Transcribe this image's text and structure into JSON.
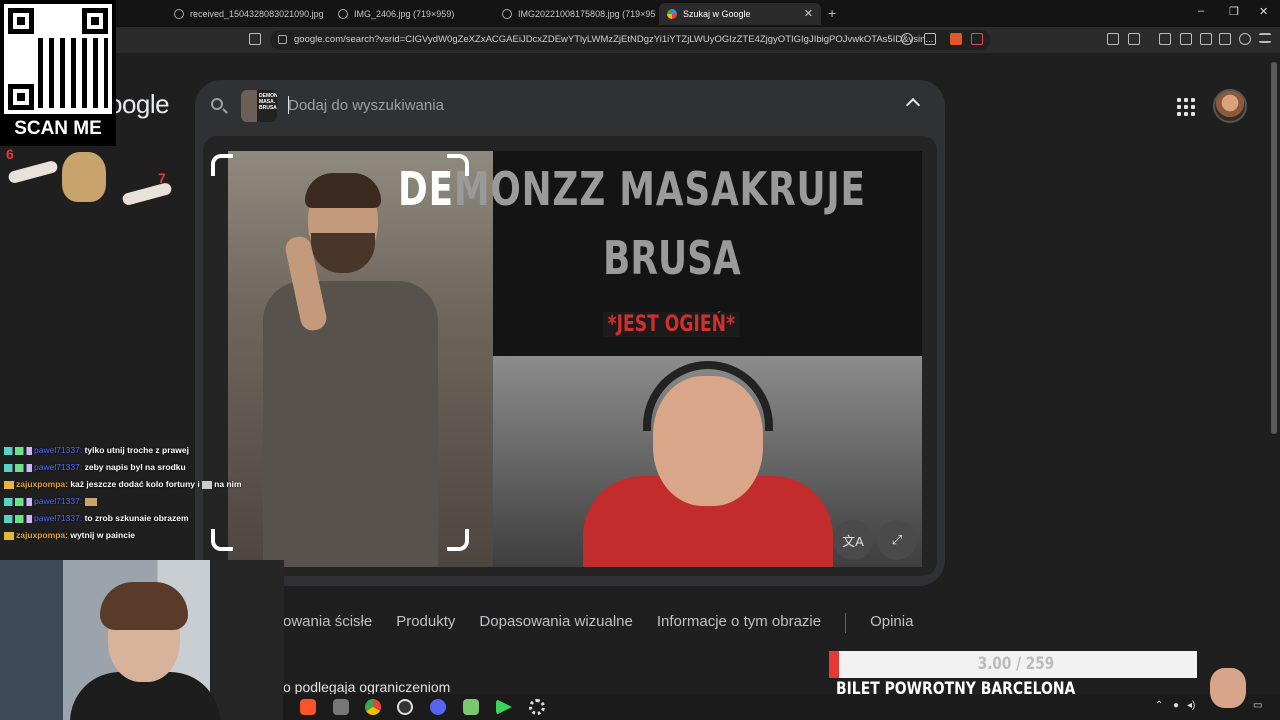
{
  "browser": {
    "tabs": [
      {
        "label": "received_1504328083021090.jpg (11..."
      },
      {
        "label": "IMG_2406.jpg (719×959)"
      },
      {
        "label": "IMG20221008175808.jpg (719×959)"
      },
      {
        "label": "Szukaj w Google"
      }
    ],
    "new_tab": "+",
    "url": "google.com/search?vsrid=CIGVydW0gZeXZxACGAEiJDcxZDEwYTlyLWMzZjEtNDgzYi1iYTZjLWUyOGIzZTE4ZjgyOTIGIgJIbigPOJvwkOTAs5ID&vsin...",
    "window_controls": [
      "–",
      "❐",
      "✕"
    ]
  },
  "google": {
    "logo": "oogle",
    "search_placeholder": "Dodaj do wyszukiwania",
    "thumb_text": "DEMONZZ MASA. BRUSA",
    "image_title_white": "DE",
    "image_title_grey": "MONZZ MASAKRUJE",
    "image_subtitle": "BRUSA",
    "image_badge": "*JEST OGIEŃ*",
    "translate_glyph": "文A",
    "expand_glyph": "⤢",
    "filters": [
      "owania ścisłe",
      "Produkty",
      "Dopasowania wizualne",
      "Informacje o tym obrazie",
      "Opinia"
    ],
    "result_text": "o podlegaja ograniczeniom"
  },
  "overlay": {
    "qr_label": "SCAN ME",
    "emote_left_number": "6",
    "emote_right_number": "7",
    "chat": [
      {
        "user": "pawel71337:",
        "message": "tylko utnij troche z prawej",
        "badge": "sword"
      },
      {
        "user": "pawel71337:",
        "message": "zeby napis byl na srodku",
        "badge": "sword"
      },
      {
        "user": "zajuxpompa:",
        "message": "każ jeszcze dodać kolo fortuny i",
        "suffix": "na nim",
        "badge": "crown"
      },
      {
        "user": "pawel71337:",
        "message": "",
        "badge": "sword"
      },
      {
        "user": "pawel71337:",
        "message": "to zrob szkunaie obrazem",
        "badge": "sword"
      },
      {
        "user": "zajuxpompa:",
        "message": "wytnij w paincie",
        "badge": "crown"
      }
    ],
    "goal": {
      "text": "3.00 / 259",
      "progress": 0.0116,
      "title": "BILET POWROTNY BARCELONA"
    }
  },
  "colors": {
    "accent_red": "#e53935",
    "chat_user_blue": "#4f6cff",
    "chat_user_gold": "#e0a52c"
  }
}
